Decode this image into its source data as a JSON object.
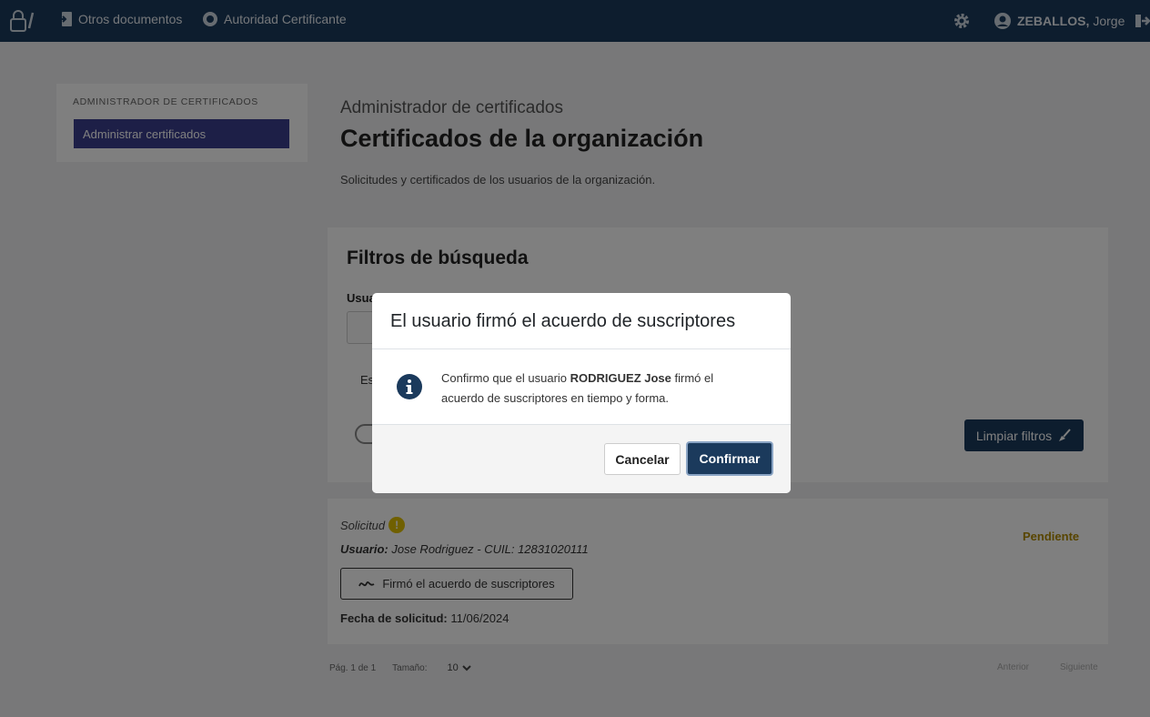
{
  "topbar": {
    "nav_docs": "Otros documentos",
    "nav_ac": "Autoridad Certificante",
    "user_last": "ZEBALLOS,",
    "user_first": "Jorge"
  },
  "sidebar": {
    "section_title": "ADMINISTRADOR DE CERTIFICADOS",
    "items": [
      {
        "label": "Administrar certificados",
        "active": true
      }
    ]
  },
  "main": {
    "breadcrumb": "Administrador de certificados",
    "title": "Certificados de la organización",
    "description": "Solicitudes y certificados de los usuarios de la organización."
  },
  "filters": {
    "title": "Filtros de búsqueda",
    "user_label": "Usuario",
    "estado_label": "Es",
    "clear_label": "Limpiar filtros"
  },
  "result": {
    "type_label": "Solicitud",
    "status": "Pendiente",
    "user_label": "Usuario:",
    "user_value": "Jose Rodriguez - CUIL: 12831020111",
    "action_label": "Firmó el acuerdo de suscriptores",
    "date_label": "Fecha de solicitud:",
    "date_value": "11/06/2024"
  },
  "pager": {
    "page_text": "Pág. 1 de 1",
    "size_label": "Tamaño:",
    "size_value": "10",
    "prev": "Anterior",
    "next": "Siguiente"
  },
  "modal": {
    "title": "El usuario firmó el acuerdo de suscriptores",
    "text_before": "Confirmo que el usuario ",
    "text_name": "RODRIGUEZ Jose",
    "text_after": " firmó el acuerdo de suscriptores en tiempo y forma.",
    "cancel": "Cancelar",
    "confirm": "Confirmar"
  },
  "colors": {
    "primary": "#1b3a5c",
    "sidebar_active": "#3b3f8f",
    "pending": "#e0c000"
  }
}
